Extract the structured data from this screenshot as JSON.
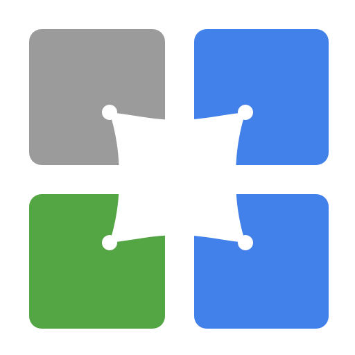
{
  "icon": {
    "name": "colored-grid-icon",
    "colors": {
      "background": "#ffffff",
      "top_left": "#9b9b9b",
      "top_right": "#4381ea",
      "bottom_left": "#54a544",
      "bottom_right": "#4381ea",
      "center_star": "#ffffff"
    }
  }
}
